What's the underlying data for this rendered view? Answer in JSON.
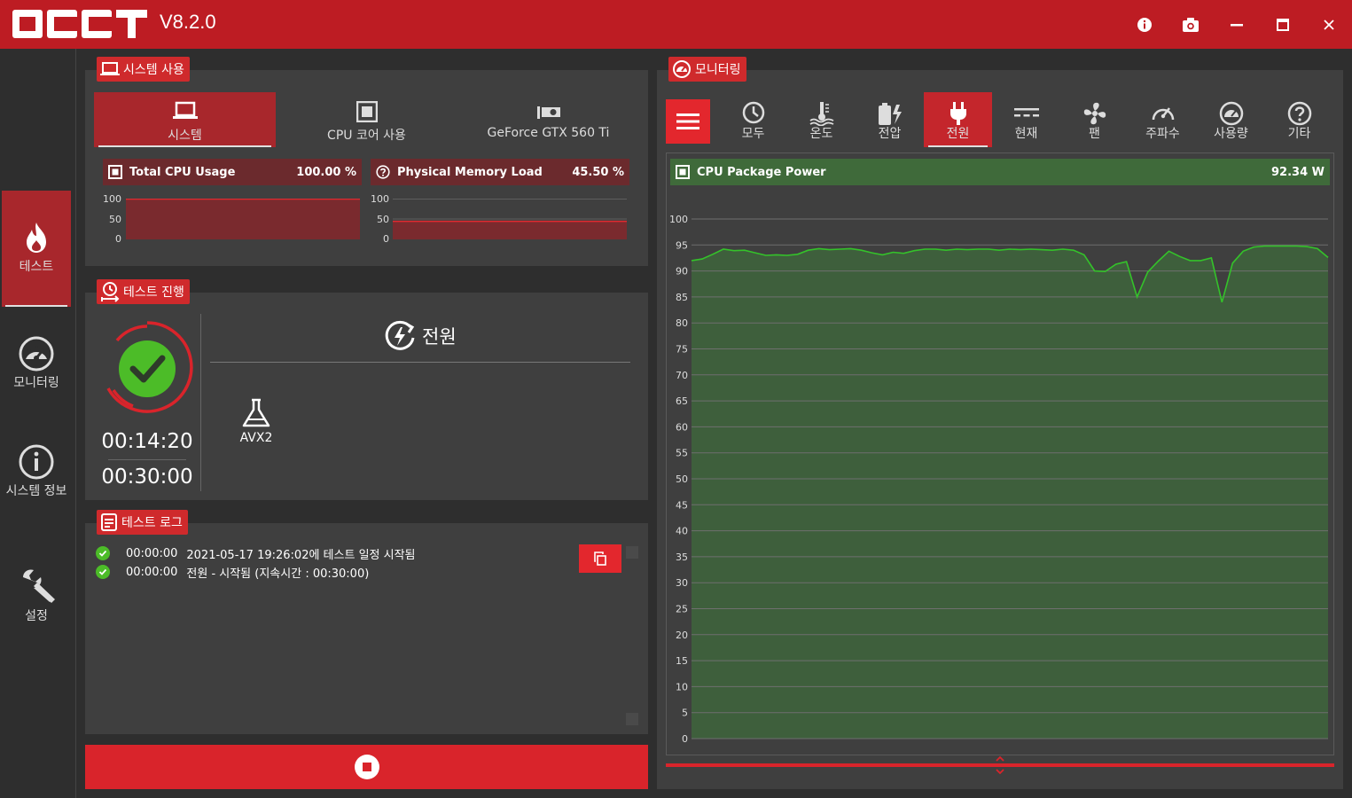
{
  "app": {
    "logo_text": "OCCT",
    "version": "V8.2.0"
  },
  "window_buttons": [
    "info-icon",
    "camera-icon",
    "minimize-icon",
    "maximize-icon",
    "close-icon"
  ],
  "sidebar": {
    "items": [
      {
        "label": "테스트",
        "icon": "flame-icon",
        "active": true
      },
      {
        "label": "모니터링",
        "icon": "gauge-icon",
        "active": false
      },
      {
        "label": "시스템 정보",
        "icon": "info-icon",
        "active": false
      },
      {
        "label": "설정",
        "icon": "wrench-icon",
        "active": false
      }
    ]
  },
  "system_usage": {
    "title": "시스템 사용",
    "tabs": [
      {
        "label": "시스템",
        "active": true
      },
      {
        "label": "CPU 코어 사용",
        "active": false
      },
      {
        "label": "GeForce GTX 560 Ti",
        "active": false
      }
    ],
    "cards": [
      {
        "title": "Total CPU Usage",
        "value": "100.00 %",
        "level": 100,
        "ticks": [
          "100",
          "50",
          "0"
        ]
      },
      {
        "title": "Physical Memory Load",
        "value": "45.50 %",
        "level": 45.5,
        "ticks": [
          "100",
          "50",
          "0"
        ]
      }
    ]
  },
  "test_progress": {
    "title": "테스트 진행",
    "elapsed": "00:14:20",
    "total": "00:30:00",
    "test_name": "전원",
    "instruction_set": "AVX2"
  },
  "test_log": {
    "title": "테스트 로그",
    "entries": [
      {
        "time": "00:00:00",
        "message": "2021-05-17 19:26:02에 테스트 일정 시작됨"
      },
      {
        "time": "00:00:00",
        "message": "전원 - 시작됨 (지속시간 : 00:30:00)"
      }
    ]
  },
  "monitoring": {
    "title": "모니터링",
    "tabs": [
      {
        "label": "모두",
        "icon": "clock-icon",
        "active": false
      },
      {
        "label": "온도",
        "icon": "thermometer-icon",
        "active": false
      },
      {
        "label": "전압",
        "icon": "battery-icon",
        "active": false
      },
      {
        "label": "전원",
        "icon": "plug-icon",
        "active": true
      },
      {
        "label": "현재",
        "icon": "dc-current-icon",
        "active": false
      },
      {
        "label": "팬",
        "icon": "fan-icon",
        "active": false
      },
      {
        "label": "주파수",
        "icon": "speedometer-icon",
        "active": false
      },
      {
        "label": "사용량",
        "icon": "gauge-icon",
        "active": false
      },
      {
        "label": "기타",
        "icon": "question-icon",
        "active": false
      }
    ]
  },
  "chart_data": {
    "type": "area",
    "title": "CPU Package Power",
    "current_value": "92.34 W",
    "ylim": [
      0,
      100
    ],
    "yticks": [
      100,
      95,
      90,
      85,
      80,
      75,
      70,
      65,
      60,
      55,
      50,
      45,
      40,
      35,
      30,
      25,
      20,
      15,
      10,
      5,
      0
    ],
    "grid": true,
    "colors": {
      "line": "#34c22a",
      "fill": "#3e5f3c"
    },
    "series": [
      {
        "values": [
          92.0,
          92.3,
          93.2,
          94.2,
          93.9,
          94.0,
          93.5,
          93.0,
          93.1,
          93.0,
          93.2,
          94.0,
          94.3,
          94.1,
          94.2,
          94.3,
          94.0,
          93.5,
          93.1,
          93.6,
          93.4,
          93.9,
          94.2,
          94.2,
          94.0,
          94.2,
          94.1,
          94.2,
          94.2,
          94.0,
          94.2,
          94.1,
          94.2,
          94.1,
          94.0,
          94.2,
          94.0,
          93.1,
          90.0,
          89.9,
          91.3,
          91.8,
          85.0,
          89.8,
          91.9,
          93.8,
          92.8,
          92.0,
          92.0,
          92.5,
          84.0,
          91.5,
          93.8,
          94.6,
          94.8,
          94.8,
          94.8,
          94.8,
          94.7,
          94.3,
          92.6
        ]
      }
    ]
  }
}
